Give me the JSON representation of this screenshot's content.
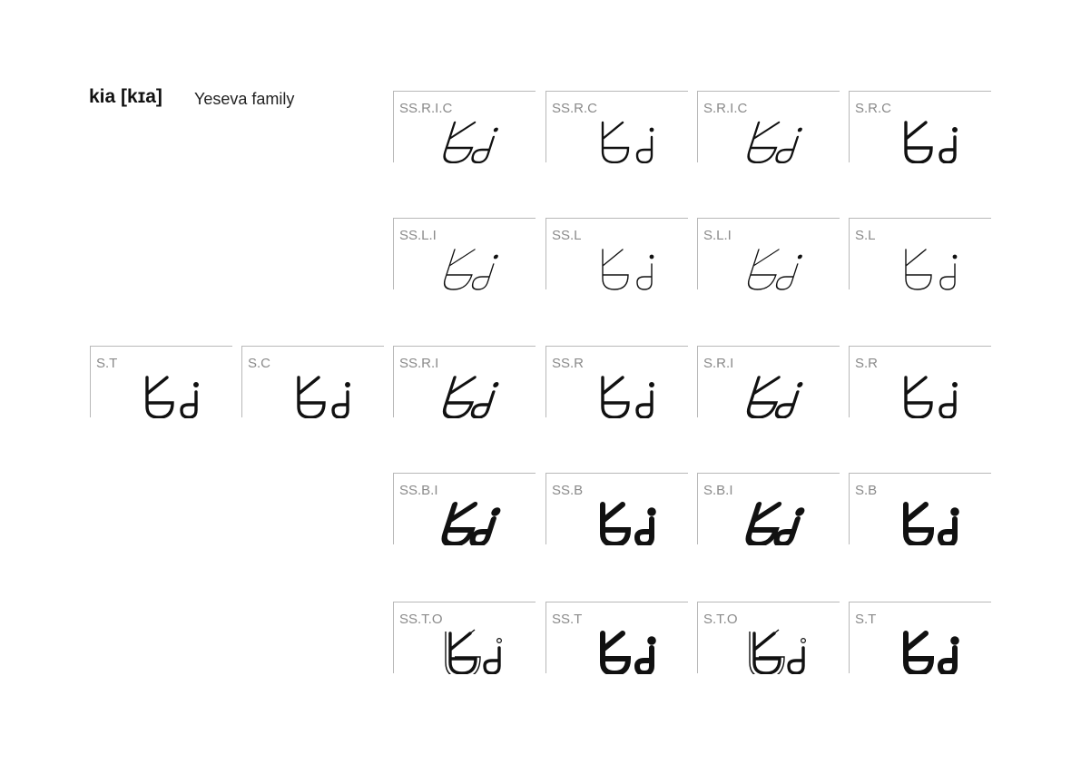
{
  "heading": {
    "word": "kia [kɪa]",
    "family": "Yeseva family"
  },
  "specimens": [
    {
      "label": "SS.R.I.C",
      "italic": true,
      "weight": "light",
      "cut": "contrast"
    },
    {
      "label": "SS.R.C",
      "italic": false,
      "weight": "light",
      "cut": "contrast"
    },
    {
      "label": "S.R.I.C",
      "italic": true,
      "weight": "light",
      "cut": "contrast"
    },
    {
      "label": "S.R.C",
      "italic": false,
      "weight": "regular",
      "cut": "contrast"
    },
    {
      "label": "SS.L.I",
      "italic": true,
      "weight": "thin",
      "cut": "light"
    },
    {
      "label": "SS.L",
      "italic": false,
      "weight": "thin",
      "cut": "light"
    },
    {
      "label": "S.L.I",
      "italic": true,
      "weight": "thin",
      "cut": "light"
    },
    {
      "label": "S.L",
      "italic": false,
      "weight": "thin",
      "cut": "light"
    },
    {
      "label": "S.T",
      "italic": false,
      "weight": "regular",
      "cut": "text"
    },
    {
      "label": "S.C",
      "italic": false,
      "weight": "regular",
      "cut": "condensed"
    },
    {
      "label": "SS.R.I",
      "italic": true,
      "weight": "regular",
      "cut": "regular"
    },
    {
      "label": "SS.R",
      "italic": false,
      "weight": "regular",
      "cut": "regular"
    },
    {
      "label": "S.R.I",
      "italic": true,
      "weight": "regular",
      "cut": "regular"
    },
    {
      "label": "S.R",
      "italic": false,
      "weight": "regular",
      "cut": "regular"
    },
    {
      "label": "SS.B.I",
      "italic": true,
      "weight": "bold",
      "cut": "bold"
    },
    {
      "label": "SS.B",
      "italic": false,
      "weight": "bold",
      "cut": "bold"
    },
    {
      "label": "S.B.I",
      "italic": true,
      "weight": "bold",
      "cut": "bold"
    },
    {
      "label": "S.B",
      "italic": false,
      "weight": "bold",
      "cut": "bold"
    },
    {
      "label": "SS.T.O",
      "italic": false,
      "weight": "regular",
      "cut": "outline"
    },
    {
      "label": "SS.T",
      "italic": false,
      "weight": "bold",
      "cut": "title"
    },
    {
      "label": "S.T.O",
      "italic": false,
      "weight": "regular",
      "cut": "outline"
    },
    {
      "label": "S.T",
      "italic": false,
      "weight": "bold",
      "cut": "title"
    }
  ],
  "colors": {
    "ink": "#111111",
    "label": "#8a8a8a",
    "rule": "#b8b8b8"
  }
}
